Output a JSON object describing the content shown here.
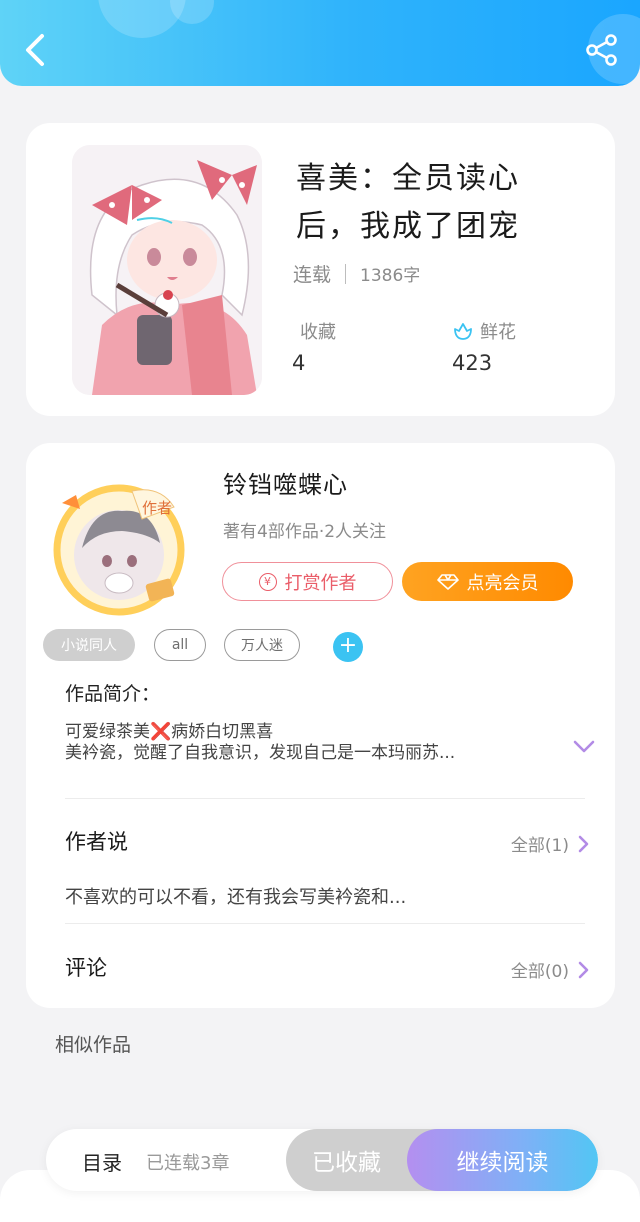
{
  "book": {
    "title": "喜美：全员读心后，我成了团宠",
    "status": "连载",
    "word_count": "1386字",
    "collect_label": "收藏",
    "collect_count": "4",
    "flower_label": "鲜花",
    "flower_count": "423"
  },
  "author": {
    "badge": "作者",
    "name": "铃铛噬蝶心",
    "stats": "著有4部作品·2人关注",
    "tip_label": "打赏作者",
    "tip_icon_glyph": "¥",
    "vip_label": "点亮会员"
  },
  "tags": [
    "小说同人",
    "all",
    "万人迷"
  ],
  "intro": {
    "heading": "作品简介：",
    "line1": "可爱绿茶美❌病娇白切黑喜",
    "line2": "美衿瓷，觉醒了自我意识，发现自己是一本玛丽苏..."
  },
  "author_says": {
    "title": "作者说",
    "all_label": "全部(1)",
    "text": "不喜欢的可以不看，还有我会写美衿瓷和..."
  },
  "comments": {
    "title": "评论",
    "all_label": "全部(0)"
  },
  "similar_label": "相似作品",
  "bottom": {
    "toc_label": "目录",
    "toc_status": "已连载3章",
    "collected_label": "已收藏",
    "continue_label": "继续阅读"
  },
  "colors": {
    "header_start": "#5fd3f7",
    "header_end": "#1aa6ff",
    "vip_orange": "#ff8a00",
    "tip_red": "#ea5d69",
    "add_blue": "#3bc3f2",
    "chevron_purple": "#b28be6"
  },
  "icons": {
    "back": "chevron-left-icon",
    "share": "share-icon",
    "flower": "flower-icon",
    "diamond": "diamond-icon",
    "expand": "chevron-down-icon",
    "more": "chevron-right-icon",
    "add": "plus-icon"
  }
}
